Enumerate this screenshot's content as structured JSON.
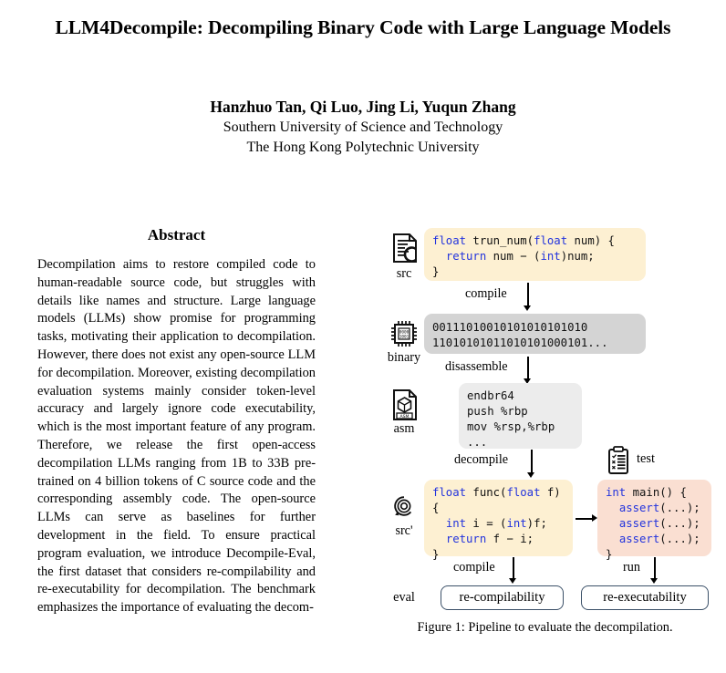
{
  "paper": {
    "title": "LLM4Decompile: Decompiling Binary Code with Large Language Models",
    "authors": "Hanzhuo Tan, Qi Luo, Jing Li, Yuqun Zhang",
    "affiliation_1": "Southern University of Science and Technology",
    "affiliation_2": "The Hong Kong Polytechnic University"
  },
  "abstract": {
    "heading": "Abstract",
    "text": "Decompilation aims to restore compiled code to human-readable source code, but struggles with details like names and structure. Large language models (LLMs) show promise for programming tasks, motivating their application to decompilation. However, there does not exist any open-source LLM for decompilation. Moreover, existing decompilation evaluation systems mainly consider token-level accuracy and largely ignore code executability, which is the most important feature of any program. Therefore, we release the first open-access decompilation LLMs ranging from 1B to 33B pre-trained on 4 billion tokens of C source code and the corresponding assembly code. The open-source LLMs can serve as baselines for further development in the field. To ensure practical program evaluation, we introduce Decompile-Eval, the first dataset that considers re-compilability and re-executability for decompilation. The benchmark emphasizes the importance of evaluating the decom-"
  },
  "figure": {
    "caption": "Figure 1: Pipeline to evaluate the decompilation.",
    "stages": {
      "src": {
        "label": "src",
        "icon": "c-source-file-icon",
        "code_line_1": "float trun_num(float num) {",
        "code_line_2": "  return num - (int)num;",
        "code_line_3": "}",
        "keywords": [
          "float",
          "return",
          "int"
        ],
        "color": "#fdf0d2"
      },
      "binary": {
        "label": "binary",
        "icon": "cpu-chip-icon",
        "code_line_1": "00111010010101010101010",
        "code_line_2": "11010101011010101000101...",
        "color": "#d4d4d4"
      },
      "asm": {
        "label": "asm",
        "icon": "asm-file-icon",
        "code_line_1": "endbr64",
        "code_line_2": "push %rbp",
        "code_line_3": "mov %rsp,%rbp",
        "code_line_4": "...",
        "color": "#ececec"
      },
      "src_prime": {
        "label": "src'",
        "icon": "recycle-spiral-icon",
        "code_line_1": "float func(float f)",
        "code_line_2": "{",
        "code_line_3": "  int i = (int)f;",
        "code_line_4": "  return f - i;",
        "code_line_5": "}",
        "color": "#fdf0d2"
      },
      "test": {
        "label": "test",
        "icon": "clipboard-test-icon",
        "code_line_1": "int main() {",
        "code_line_2": "  assert(...);",
        "code_line_3": "  assert(...);",
        "code_line_4": "  assert(...);",
        "code_line_5": "}",
        "color": "#fadfd2"
      },
      "eval": {
        "label": "eval",
        "box_1": "re-compilability",
        "box_2": "re-executability",
        "border_color": "#3b5068"
      }
    },
    "arrows": {
      "compile_1": "compile",
      "disassemble": "disassemble",
      "decompile": "decompile",
      "compile_2": "compile",
      "run": "run"
    }
  }
}
